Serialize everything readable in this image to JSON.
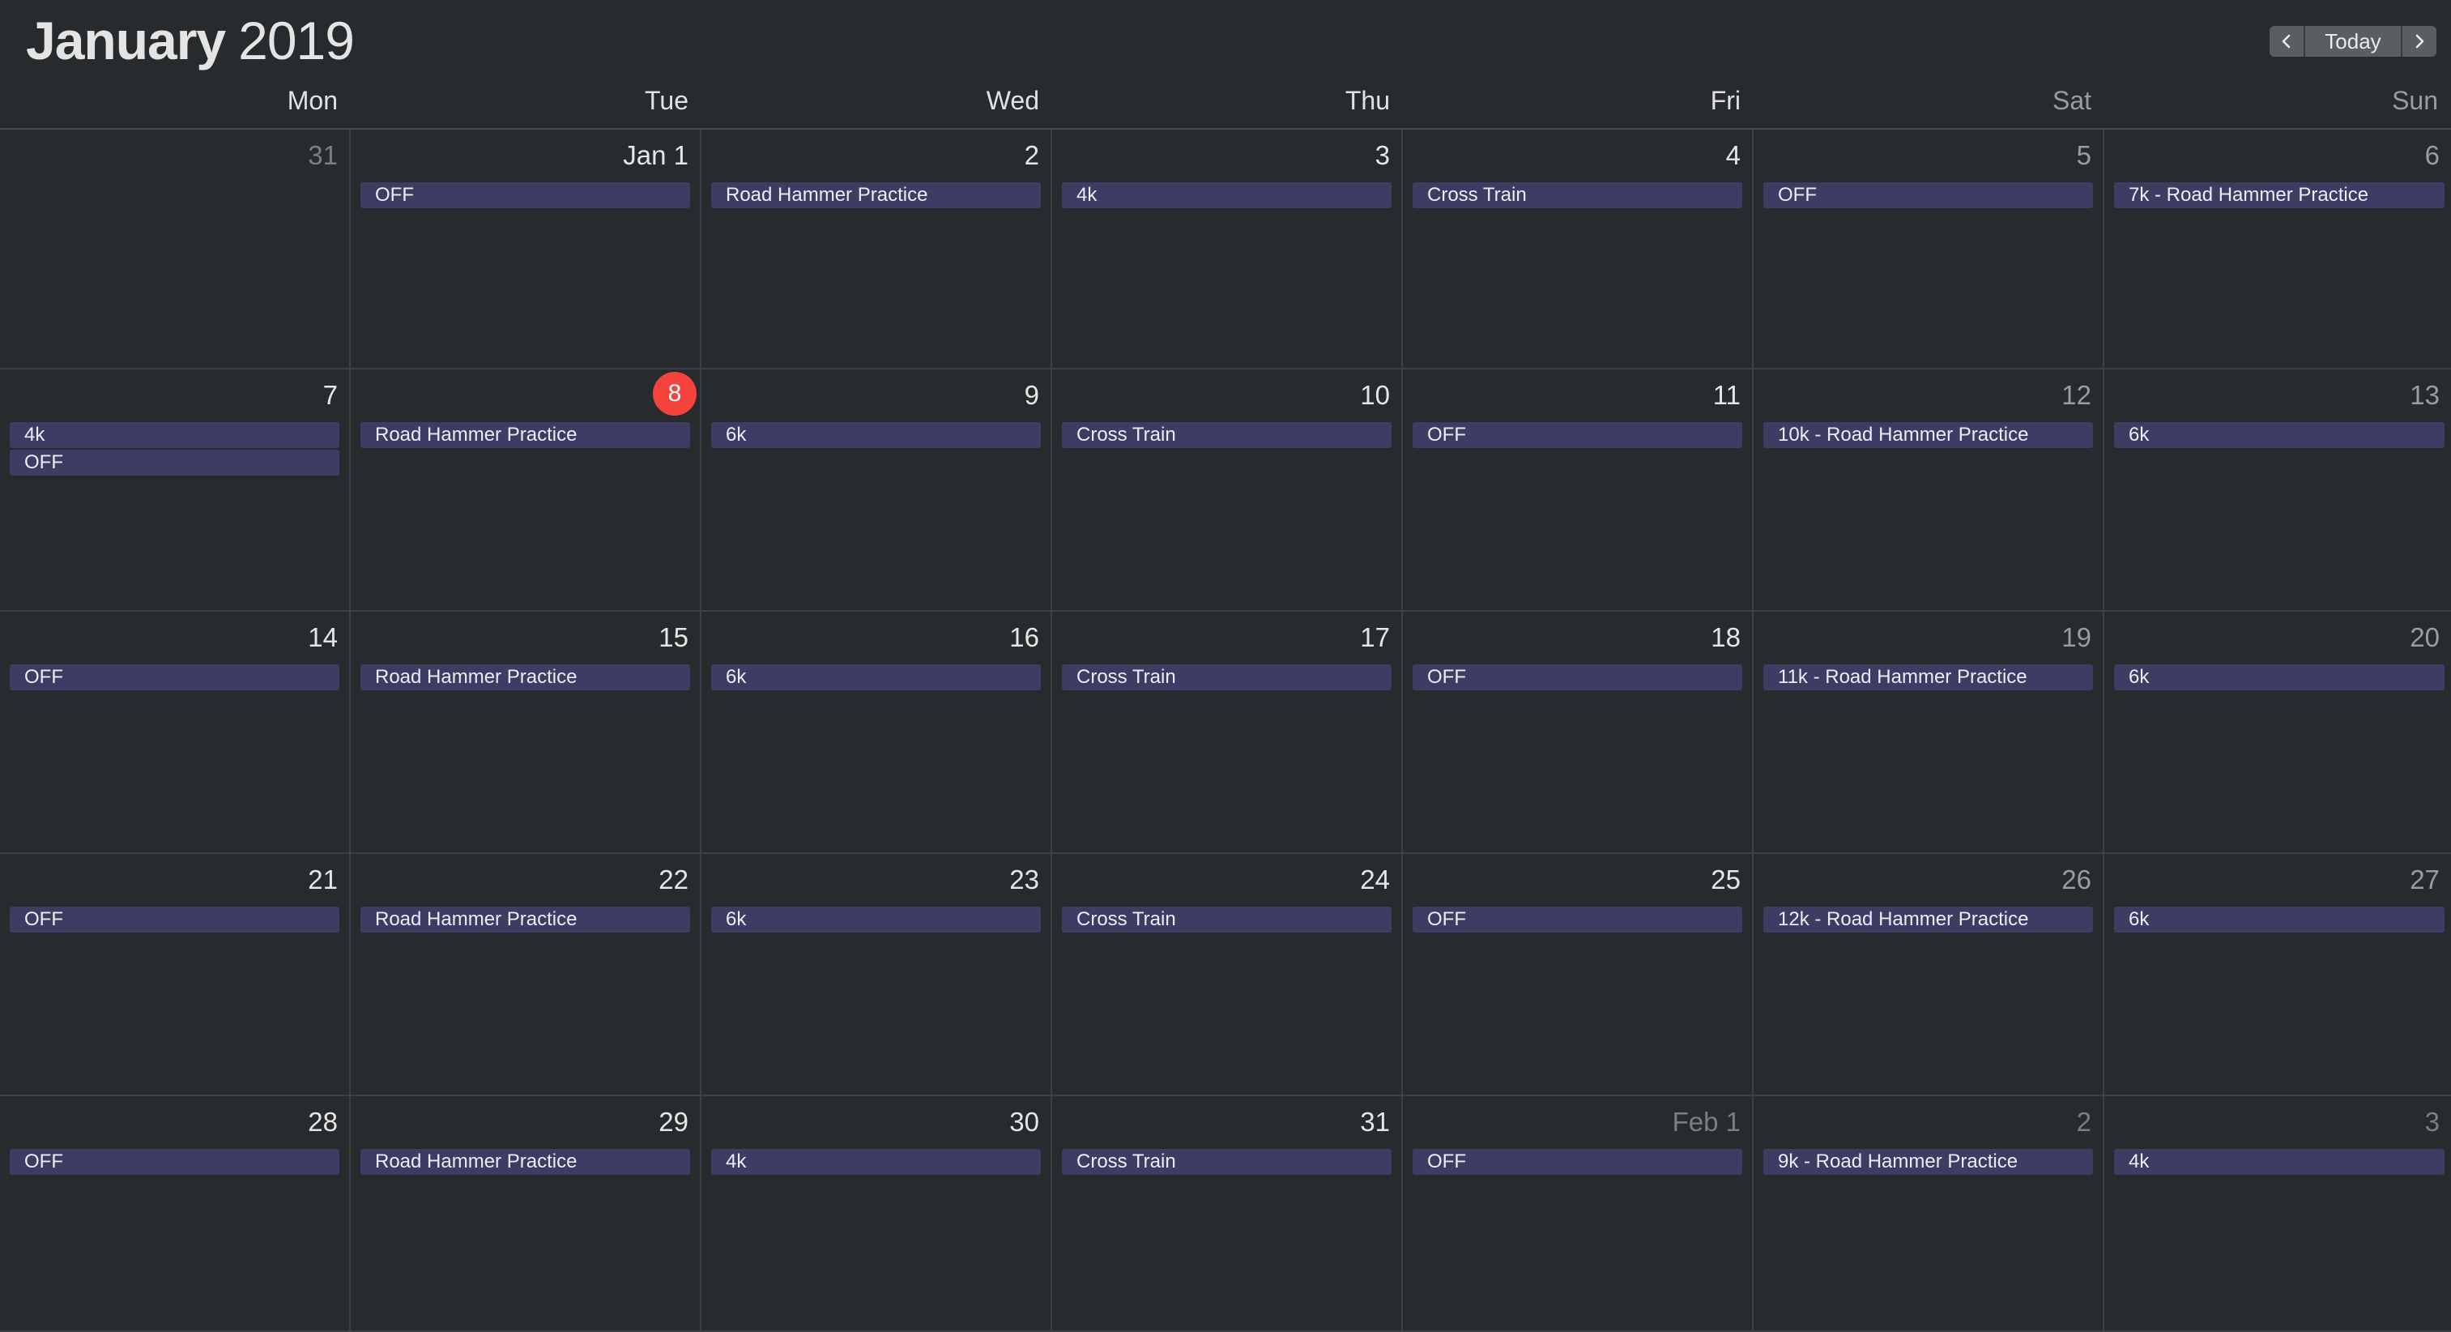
{
  "header": {
    "month": "January",
    "year": "2019",
    "today_label": "Today",
    "prev_icon": "chevron-left-icon",
    "next_icon": "chevron-right-icon"
  },
  "weekdays": [
    "Mon",
    "Tue",
    "Wed",
    "Thu",
    "Fri",
    "Sat",
    "Sun"
  ],
  "colors": {
    "background": "#272b2d",
    "event_bg": "#3e3c62",
    "today_badge": "#f5423d"
  },
  "weeks": [
    [
      {
        "label": "31",
        "dim": true,
        "events": []
      },
      {
        "label": "Jan 1",
        "events": [
          "OFF"
        ]
      },
      {
        "label": "2",
        "events": [
          "Road Hammer Practice"
        ]
      },
      {
        "label": "3",
        "events": [
          "4k"
        ]
      },
      {
        "label": "4",
        "events": [
          "Cross Train"
        ]
      },
      {
        "label": "5",
        "events": [
          "OFF"
        ]
      },
      {
        "label": "6",
        "events": [
          "7k - Road Hammer Practice"
        ]
      }
    ],
    [
      {
        "label": "7",
        "events": [
          "4k",
          "OFF"
        ]
      },
      {
        "label": "8",
        "today": true,
        "events": [
          "Road Hammer Practice"
        ]
      },
      {
        "label": "9",
        "events": [
          "6k"
        ]
      },
      {
        "label": "10",
        "events": [
          "Cross Train"
        ]
      },
      {
        "label": "11",
        "events": [
          "OFF"
        ]
      },
      {
        "label": "12",
        "events": [
          "10k - Road Hammer Practice"
        ]
      },
      {
        "label": "13",
        "events": [
          "6k"
        ]
      }
    ],
    [
      {
        "label": "14",
        "events": [
          "OFF"
        ]
      },
      {
        "label": "15",
        "events": [
          "Road Hammer Practice"
        ]
      },
      {
        "label": "16",
        "events": [
          "6k"
        ]
      },
      {
        "label": "17",
        "events": [
          "Cross Train"
        ]
      },
      {
        "label": "18",
        "events": [
          "OFF"
        ]
      },
      {
        "label": "19",
        "events": [
          "11k - Road Hammer Practice"
        ]
      },
      {
        "label": "20",
        "events": [
          "6k"
        ]
      }
    ],
    [
      {
        "label": "21",
        "events": [
          "OFF"
        ]
      },
      {
        "label": "22",
        "events": [
          "Road Hammer Practice"
        ]
      },
      {
        "label": "23",
        "events": [
          "6k"
        ]
      },
      {
        "label": "24",
        "events": [
          "Cross Train"
        ]
      },
      {
        "label": "25",
        "events": [
          "OFF"
        ]
      },
      {
        "label": "26",
        "events": [
          "12k - Road Hammer Practice"
        ]
      },
      {
        "label": "27",
        "events": [
          "6k"
        ]
      }
    ],
    [
      {
        "label": "28",
        "events": [
          "OFF"
        ]
      },
      {
        "label": "29",
        "events": [
          "Road Hammer Practice"
        ]
      },
      {
        "label": "30",
        "events": [
          "4k"
        ]
      },
      {
        "label": "31",
        "events": [
          "Cross Train"
        ]
      },
      {
        "label": "Feb 1",
        "dim": true,
        "events": [
          "OFF"
        ]
      },
      {
        "label": "2",
        "dim": true,
        "events": [
          "9k - Road Hammer Practice"
        ]
      },
      {
        "label": "3",
        "dim": true,
        "events": [
          "4k"
        ]
      }
    ]
  ]
}
